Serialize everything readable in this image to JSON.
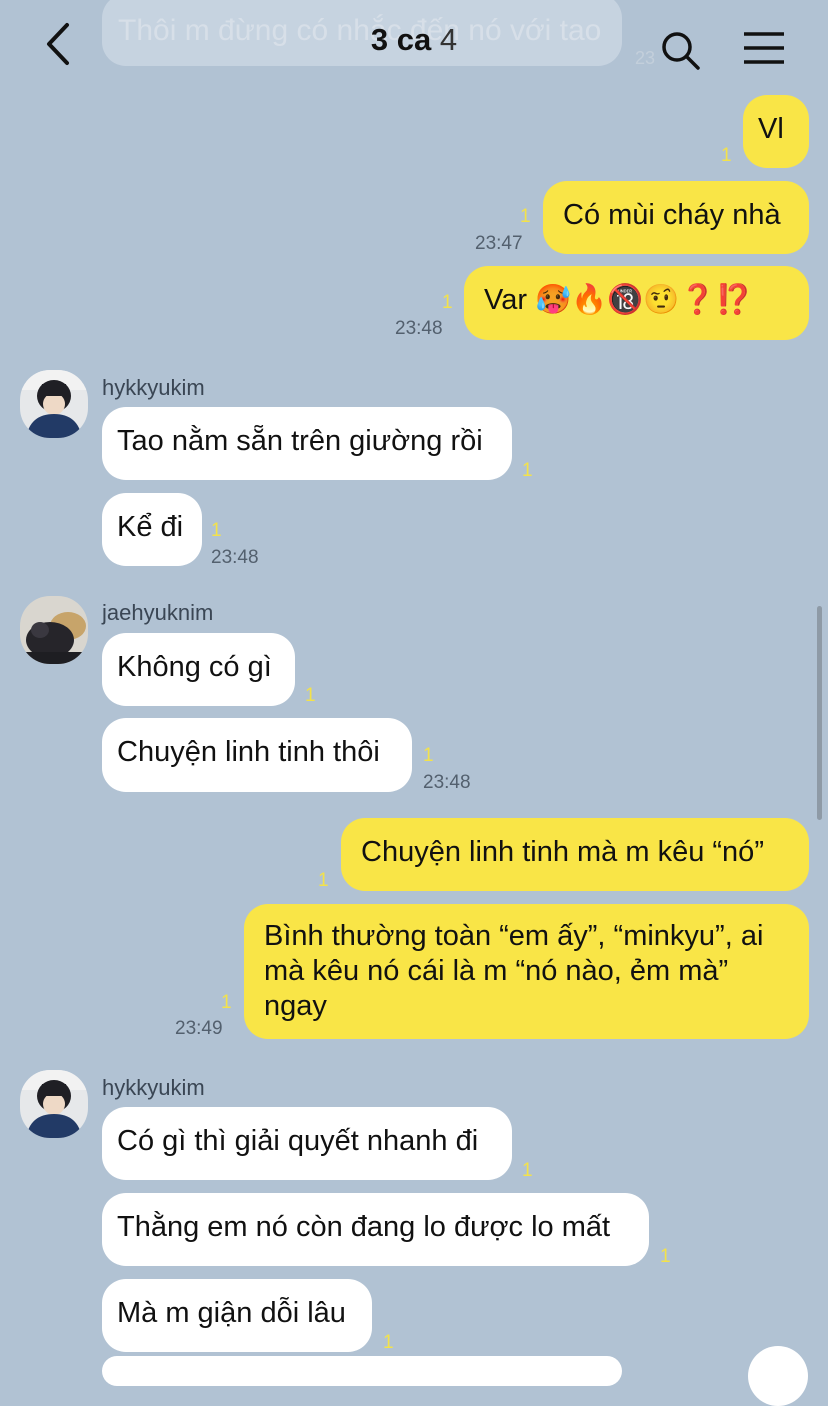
{
  "header": {
    "title_main": "3 ca",
    "title_count": "4",
    "faded_message": "Thôi m đừng có nhắc đến nó với tao",
    "faded_time": "23"
  },
  "messages": [
    {
      "text": "Vl",
      "read": "1"
    },
    {
      "text": "Có mùi cháy nhà",
      "read": "1",
      "time": "23:47"
    },
    {
      "text": "Var 🥵🔥🔞🤨❓⁉️",
      "read": "1",
      "time": "23:48"
    },
    {
      "sender": "hykkyukim",
      "text": "Tao nằm sẵn trên giường rồi",
      "read": "1"
    },
    {
      "text": "Kể đi",
      "read": "1",
      "time": "23:48"
    },
    {
      "sender": "jaehyuknim",
      "text": "Không có gì",
      "read": "1"
    },
    {
      "text": "Chuyện linh tinh thôi",
      "read": "1",
      "time": "23:48"
    },
    {
      "text": "Chuyện linh tinh mà m kêu “nó”",
      "read": "1"
    },
    {
      "text": "Bình thường toàn “em ấy”, “minkyu”, ai mà kêu nó cái là m “nó nào, ẻm mà” ngay",
      "read": "1",
      "time": "23:49"
    },
    {
      "sender": "hykkyukim",
      "text": "Có gì thì giải quyết nhanh đi",
      "read": "1"
    },
    {
      "text": "Thằng em nó còn đang lo được lo mất",
      "read": "1"
    },
    {
      "text": "Mà m giận dỗi lâu",
      "read": "1"
    }
  ],
  "colors": {
    "background": "#b1c2d3",
    "my_bubble": "#f9e547",
    "their_bubble": "#ffffff",
    "read_count": "#f3e24a"
  },
  "icons": [
    "back-icon",
    "search-icon",
    "menu-icon"
  ]
}
